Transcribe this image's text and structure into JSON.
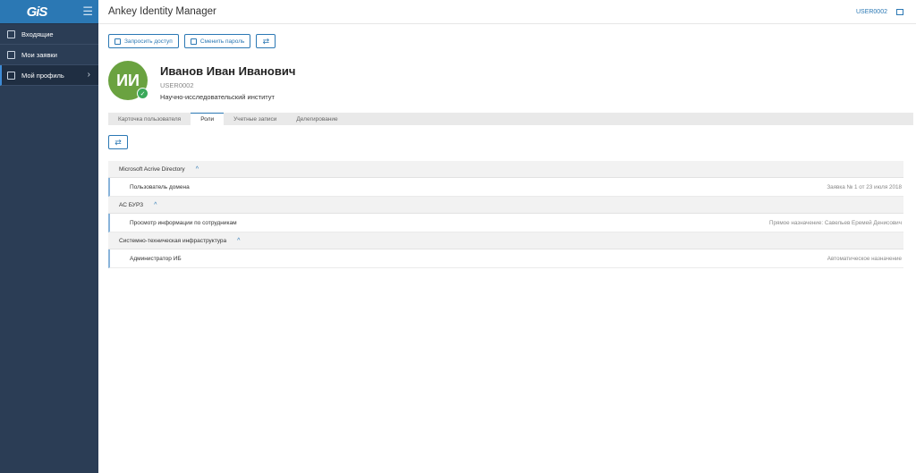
{
  "sidebar": {
    "logo": "GiS",
    "menu_icon": "hamburger-icon",
    "items": [
      {
        "label": "Входящие",
        "icon": "inbox-icon",
        "active": false
      },
      {
        "label": "Мои заявки",
        "icon": "list-icon",
        "active": false
      },
      {
        "label": "Мой профиль",
        "icon": "profile-icon",
        "active": true
      }
    ]
  },
  "header": {
    "title": "Ankey Identity Manager",
    "user": "USER0002"
  },
  "toolbar": {
    "request_access": "Запросить доступ",
    "change_password": "Сменить пароль"
  },
  "profile": {
    "initials": "ИИ",
    "name": "Иванов Иван Иванович",
    "login": "USER0002",
    "organization": "Научно-исследовательский институт"
  },
  "tabs": [
    {
      "label": "Карточка пользователя",
      "active": false
    },
    {
      "label": "Роли",
      "active": true
    },
    {
      "label": "Учетные записи",
      "active": false
    },
    {
      "label": "Делегирование",
      "active": false
    }
  ],
  "groups": [
    {
      "name": "Microsoft Acrive Directory",
      "roles": [
        {
          "name": "Пользователь домена",
          "source": "Заявка № 1 от 23 июля 2018"
        }
      ]
    },
    {
      "name": "АС БУРЗ",
      "roles": [
        {
          "name": "Просмотр информации по сотрудникам",
          "source": "Прямое назначение: Савельев Еремей Денисович"
        }
      ]
    },
    {
      "name": "Системно-техническая инфраструктура",
      "roles": [
        {
          "name": "Администратор ИБ",
          "source": "Автоматическое назначение"
        }
      ]
    }
  ],
  "colors": {
    "sidebar": "#2b3d55",
    "accent": "#2b78b4",
    "avatar": "#6aa240"
  }
}
